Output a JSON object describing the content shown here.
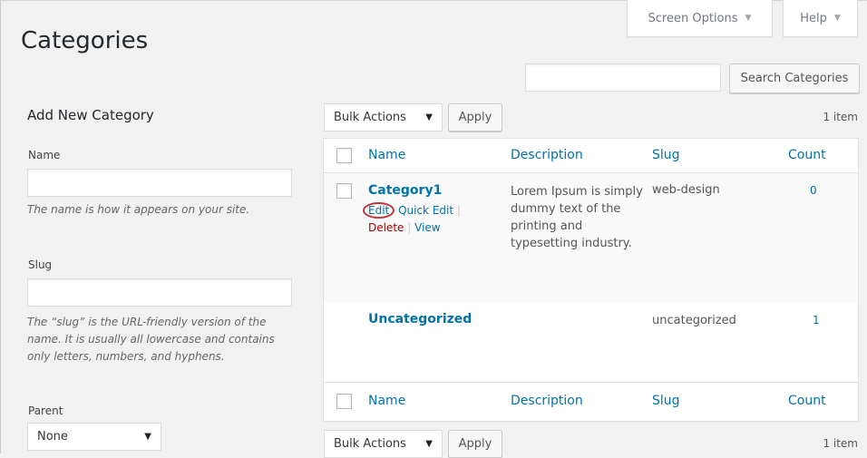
{
  "header": {
    "title": "Categories",
    "screen_options": "Screen Options",
    "help": "Help"
  },
  "search": {
    "placeholder": "",
    "button_label": "Search Categories"
  },
  "add_form": {
    "heading": "Add New Category",
    "name_label": "Name",
    "name_value": "",
    "name_help": "The name is how it appears on your site.",
    "slug_label": "Slug",
    "slug_value": "",
    "slug_help": "The “slug” is the URL-friendly version of the name. It is usually all lowercase and contains only letters, numbers, and hyphens.",
    "parent_label": "Parent",
    "parent_value": "None"
  },
  "table_nav": {
    "bulk_actions": "Bulk Actions",
    "apply": "Apply",
    "item_count": "1 item"
  },
  "table": {
    "columns": [
      "Name",
      "Description",
      "Slug",
      "Count"
    ],
    "rows": [
      {
        "name": "Category1",
        "description": "Lorem Ipsum is simply dummy text of the printing and typesetting industry.",
        "slug": "web-design",
        "count": "0",
        "actions": {
          "edit": "Edit",
          "quick_edit": "Quick Edit",
          "delete": "Delete",
          "view": "View",
          "sep": "|"
        }
      },
      {
        "name": "Uncategorized",
        "description": "",
        "slug": "uncategorized",
        "count": "1"
      }
    ]
  },
  "colors": {
    "link": "#0073aa",
    "delete": "#a00",
    "highlight_ring": "#c0353a",
    "background": "#f1f1f1"
  },
  "icons": {
    "dropdown": "caret-down-icon",
    "tab_arrow": "triangle-down-icon"
  }
}
